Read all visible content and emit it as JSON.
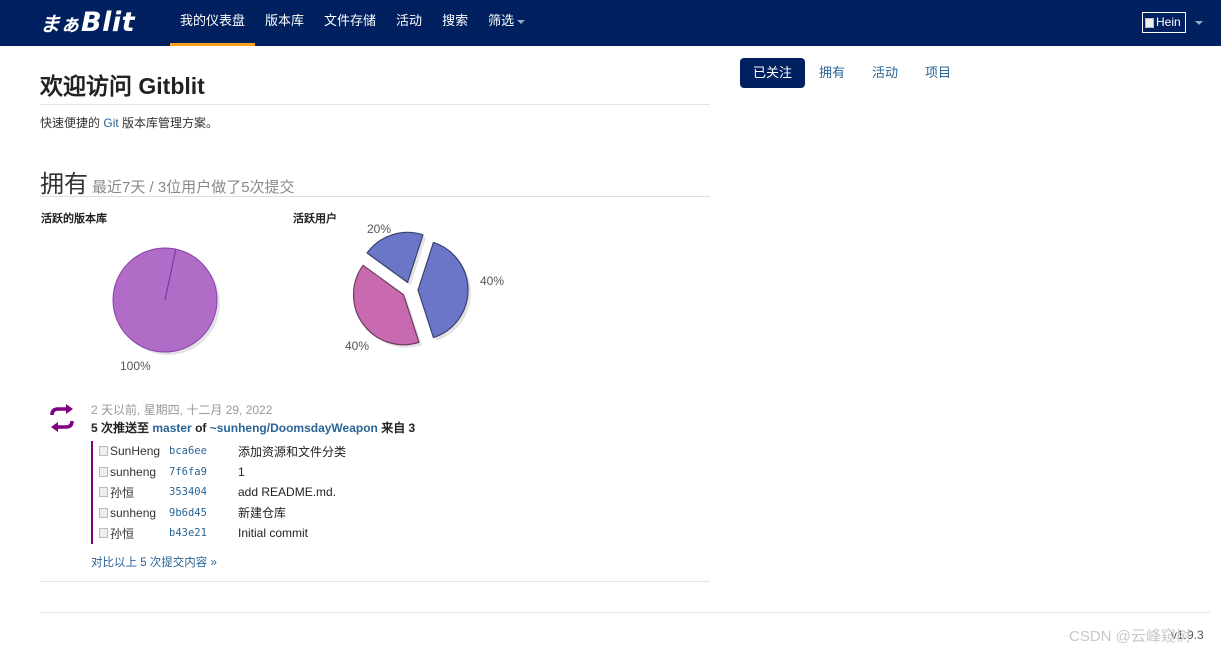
{
  "navbar": {
    "brand_mark": "まぁ",
    "brand_text": "Blit",
    "items": [
      {
        "label": "我的仪表盘",
        "active": true
      },
      {
        "label": "版本库"
      },
      {
        "label": "文件存储"
      },
      {
        "label": "活动"
      },
      {
        "label": "搜索"
      },
      {
        "label": "筛选",
        "dropdown": true
      }
    ],
    "user_label": "Hein"
  },
  "welcome": {
    "title": "欢迎访问 Gitblit",
    "subtitle_prefix": "快速便捷的",
    "subtitle_link": "Git",
    "subtitle_suffix": "版本库管理方案。"
  },
  "owned": {
    "title": "拥有",
    "subtitle": "最近7天 / 3位用户做了5次提交"
  },
  "charts": {
    "repos_label": "活跃的版本库",
    "users_label": "活跃用户"
  },
  "chart_data": [
    {
      "type": "pie",
      "title": "活跃的版本库",
      "labels": [
        "100%"
      ],
      "values": [
        100
      ],
      "colors": [
        "#b06cc6"
      ]
    },
    {
      "type": "pie",
      "title": "活跃用户",
      "labels": [
        "40%",
        "40%",
        "20%"
      ],
      "values": [
        40,
        40,
        20
      ],
      "colors": [
        "#6b76c8",
        "#c96ab0",
        "#6b76c8"
      ]
    }
  ],
  "activity": {
    "date": "2 天以前, 星期四, 十二月 29, 2022",
    "head_prefix": "5 次推送至",
    "branch": "master",
    "of": "of",
    "repo": "~sunheng/DoomsdayWeapon",
    "from": "来自 3",
    "commits": [
      {
        "author": "SunHeng",
        "sha": "bca6ee",
        "message": "添加资源和文件分类"
      },
      {
        "author": "sunheng",
        "sha": "7f6fa9",
        "message": "1"
      },
      {
        "author": "孙恒",
        "sha": "353404",
        "message": "add README.md."
      },
      {
        "author": "sunheng",
        "sha": "9b6d45",
        "message": "新建仓库"
      },
      {
        "author": "孙恒",
        "sha": "b43e21",
        "message": "Initial commit"
      }
    ],
    "compare_link": "对比以上 5 次提交内容 »"
  },
  "tabs": [
    "已关注",
    "拥有",
    "活动",
    "项目"
  ],
  "footer": {
    "version": "v1.9.3",
    "watermark": "CSDN @云峰窥树"
  },
  "colors": {
    "navbar_bg": "#002060",
    "active_underline": "#f7a21d",
    "link": "#2a6496",
    "commit_border": "#800080",
    "activity_icon": "#800080"
  },
  "icons": {
    "activity": "push-sync-icon",
    "avatar": "broken-image-icon"
  }
}
